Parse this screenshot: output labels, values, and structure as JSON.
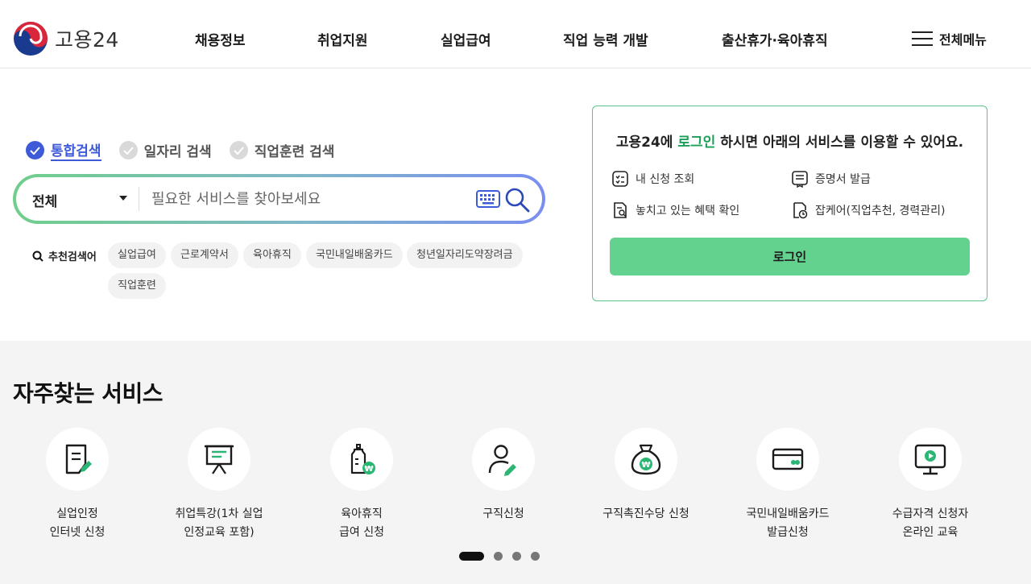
{
  "brand": {
    "name": "고용24"
  },
  "nav": {
    "items": [
      "채용정보",
      "취업지원",
      "실업급여",
      "직업 능력 개발",
      "출산휴가·육아휴직"
    ],
    "all_menu": "전체메뉴"
  },
  "search": {
    "tabs": [
      {
        "label": "통합검색",
        "active": true
      },
      {
        "label": "일자리 검색",
        "active": false
      },
      {
        "label": "직업훈련 검색",
        "active": false
      }
    ],
    "category": "전체",
    "placeholder": "필요한 서비스를 찾아보세요",
    "recommended_label": "추천검색어",
    "keywords": [
      "실업급여",
      "근로계약서",
      "육아휴직",
      "국민내일배움카드",
      "청년일자리도약장려금",
      "직업훈련"
    ]
  },
  "login_box": {
    "title_prefix": "고용24에 ",
    "title_highlight": "로그인",
    "title_suffix": " 하시면 아래의 서비스를 이용할 수 있어요.",
    "services": [
      "내 신청 조회",
      "증명서 발급",
      "놓치고 있는 혜택 확인",
      "잡케어(직업추천, 경력관리)"
    ],
    "button": "로그인"
  },
  "frequent": {
    "title": "자주찾는 서비스",
    "items": [
      {
        "line1": "실업인정",
        "line2": "인터넷 신청",
        "icon": "document-edit-icon"
      },
      {
        "line1": "취업특강(1차 실업",
        "line2": "인정교육 포함)",
        "icon": "presentation-board-icon"
      },
      {
        "line1": "육아휴직",
        "line2": "급여 신청",
        "icon": "baby-bottle-icon"
      },
      {
        "line1": "구직신청",
        "line2": "",
        "icon": "person-edit-icon"
      },
      {
        "line1": "구직촉진수당 신청",
        "line2": "",
        "icon": "money-bag-icon"
      },
      {
        "line1": "국민내일배움카드",
        "line2": "발급신청",
        "icon": "card-icon"
      },
      {
        "line1": "수급자격 신청자",
        "line2": "온라인 교육",
        "icon": "monitor-play-icon"
      }
    ],
    "pagination": {
      "pages": 4,
      "current": 1
    }
  },
  "colors": {
    "accent_green": "#1d9e59",
    "button_green": "#63d28f",
    "accent_blue": "#3d5bd9"
  }
}
